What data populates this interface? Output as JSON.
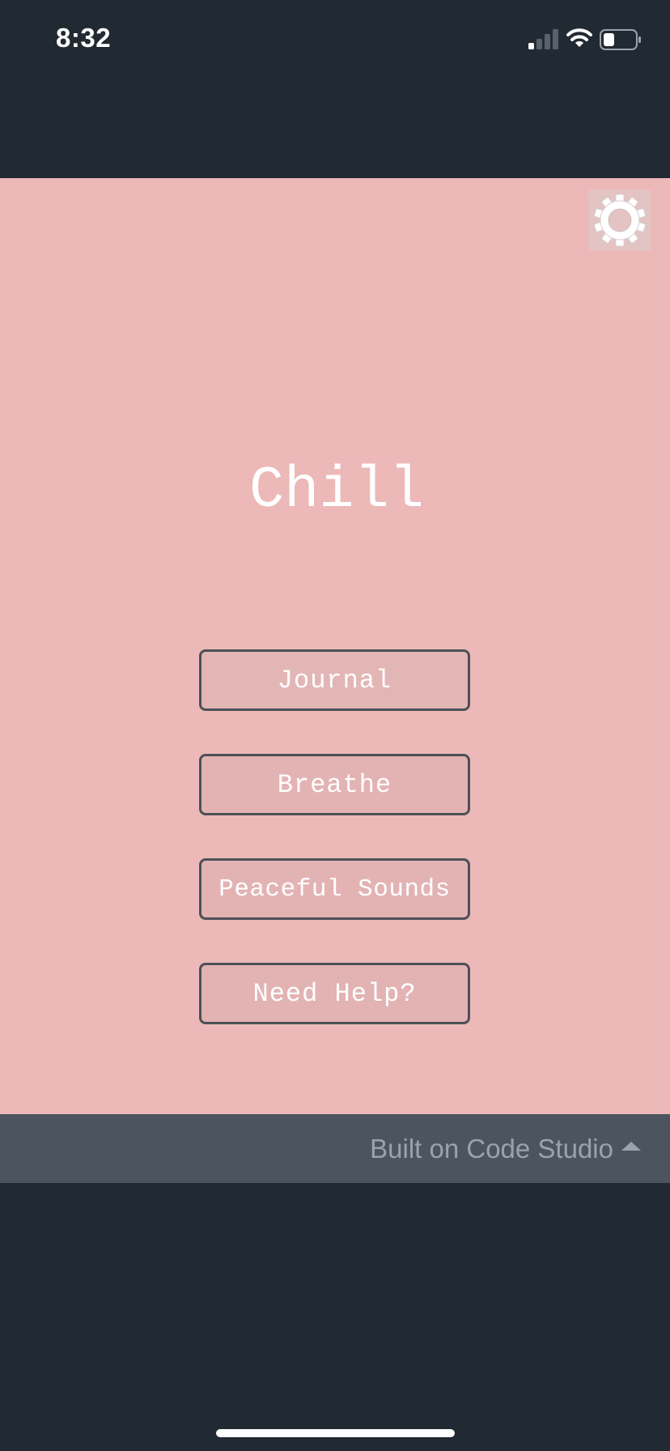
{
  "status_bar": {
    "time": "8:32",
    "signal_icon": "cellular-signal-icon",
    "wifi_icon": "wifi-icon",
    "battery_icon": "battery-icon",
    "battery_level": 0.35
  },
  "app": {
    "background_color": "#ecb8b8",
    "settings_icon": "gear-icon",
    "title": "Chill",
    "buttons": {
      "journal": "Journal",
      "breathe": "Breathe",
      "peaceful_sounds": "Peaceful Sounds",
      "need_help": "Need Help?"
    }
  },
  "footer": {
    "label": "Built on Code Studio",
    "icon": "caret-up-icon"
  }
}
